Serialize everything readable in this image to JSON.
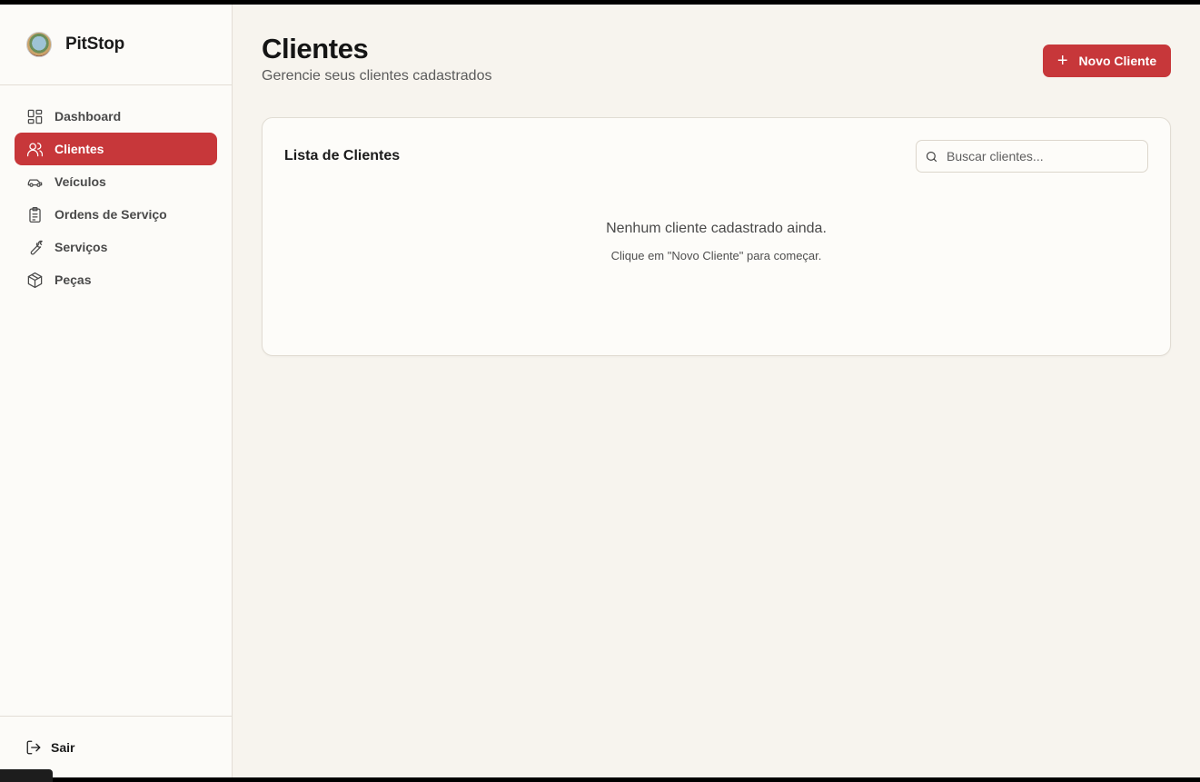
{
  "app": {
    "name": "PitStop"
  },
  "sidebar": {
    "items": [
      {
        "label": "Dashboard",
        "icon": "dashboard-icon",
        "active": false
      },
      {
        "label": "Clientes",
        "icon": "users-icon",
        "active": true
      },
      {
        "label": "Veículos",
        "icon": "car-icon",
        "active": false
      },
      {
        "label": "Ordens de Serviço",
        "icon": "clipboard-icon",
        "active": false
      },
      {
        "label": "Serviços",
        "icon": "wrench-icon",
        "active": false
      },
      {
        "label": "Peças",
        "icon": "package-icon",
        "active": false
      }
    ],
    "logout_label": "Sair"
  },
  "header": {
    "title": "Clientes",
    "subtitle": "Gerencie seus clientes cadastrados",
    "new_button_icon": "+",
    "new_button_label": "Novo Cliente"
  },
  "list": {
    "title": "Lista de Clientes",
    "search_placeholder": "Buscar clientes...",
    "search_value": "",
    "empty_title": "Nenhum cliente cadastrado ainda.",
    "empty_hint": "Clique em \"Novo Cliente\" para começar."
  },
  "colors": {
    "accent": "#c7373a",
    "background": "#f7f4ee",
    "sidebar": "#fcfbf8"
  }
}
